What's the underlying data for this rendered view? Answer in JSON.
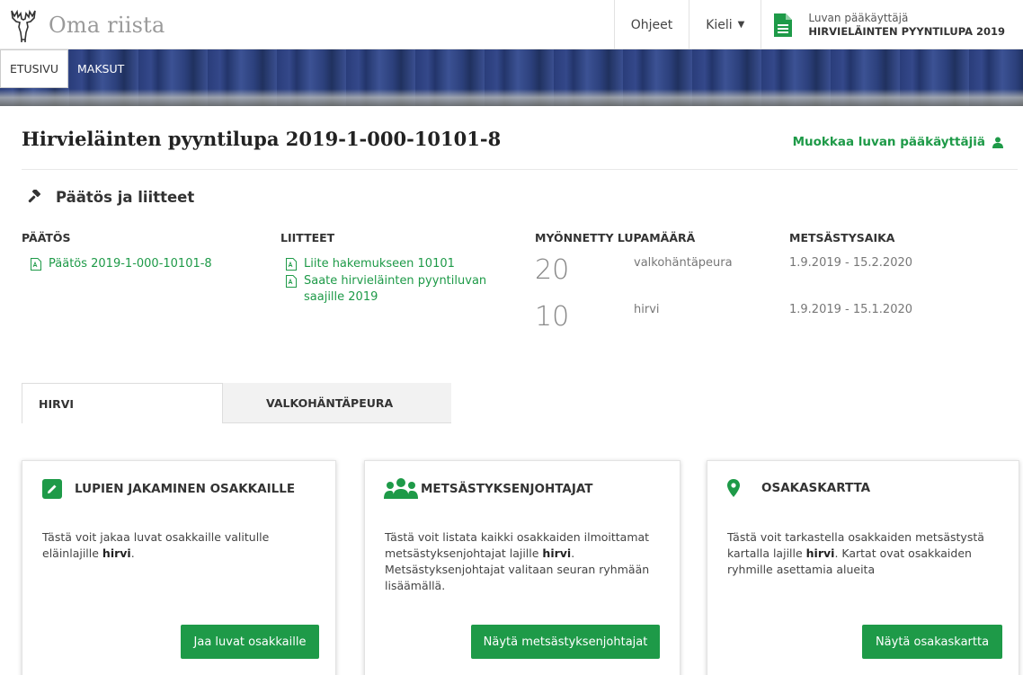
{
  "app": {
    "title": "Oma riista"
  },
  "topnav": {
    "help": "Ohjeet",
    "language": "Kieli",
    "account_role": "Luvan pääkäyttäjä",
    "account_name": "HIRVIELÄINTEN PYYNTILUPA 2019"
  },
  "tabs_top": [
    {
      "label": "ETUSIVU"
    },
    {
      "label": "MAKSUT"
    }
  ],
  "page": {
    "title": "Hirvieläinten pyyntilupa 2019-1-000-10101-8",
    "edit_admins": "Muokkaa luvan pääkäyttäjiä"
  },
  "decision": {
    "section_title": "Päätös ja liitteet",
    "col_decision": "PÄÄTÖS",
    "col_attachments": "LIITTEET",
    "col_amount": "MYÖNNETTY LUPAMÄÄRÄ",
    "col_period": "METSÄSTYSAIKA",
    "decision_link": "Päätös 2019-1-000-10101-8",
    "attachments": [
      "Liite hakemukseen 10101",
      "Saate hirvieläinten pyyntiluvan saajille 2019"
    ],
    "permits": [
      {
        "amount": "20",
        "species": "valkohäntäpeura",
        "period": "1.9.2019 - 15.2.2020"
      },
      {
        "amount": "10",
        "species": "hirvi",
        "period": "1.9.2019 - 15.1.2020"
      }
    ]
  },
  "species_tabs": [
    {
      "label": "HIRVI"
    },
    {
      "label": "VALKOHÄNTÄPEURA"
    }
  ],
  "cards": [
    {
      "title": "LUPIEN JAKAMINEN OSAKKAILLE",
      "text_pre": "Tästä voit jakaa luvat osakkaille valitulle eläinlajille ",
      "text_bold": "hirvi",
      "text_post": ".",
      "button": "Jaa luvat osakkaille"
    },
    {
      "title": "METSÄSTYKSENJOHTAJAT",
      "text_pre": "Tästä voit listata kaikki osakkaiden ilmoittamat metsästyksenjohtajat lajille ",
      "text_bold": "hirvi",
      "text_post": ". Metsästyksenjohtajat valitaan seuran ryhmään lisäämällä.",
      "button": "Näytä metsästyksenjohtajat"
    },
    {
      "title": "OSAKASKARTTA",
      "text_pre": "Tästä voit tarkastella osakkaiden metsästystä kartalla lajille ",
      "text_bold": "hirvi",
      "text_post": ". Kartat ovat osakkaiden ryhmille asettamia alueita",
      "button": "Näytä osakaskartta"
    }
  ],
  "colors": {
    "accent": "#1e9a48",
    "banner": "#2c407c"
  }
}
